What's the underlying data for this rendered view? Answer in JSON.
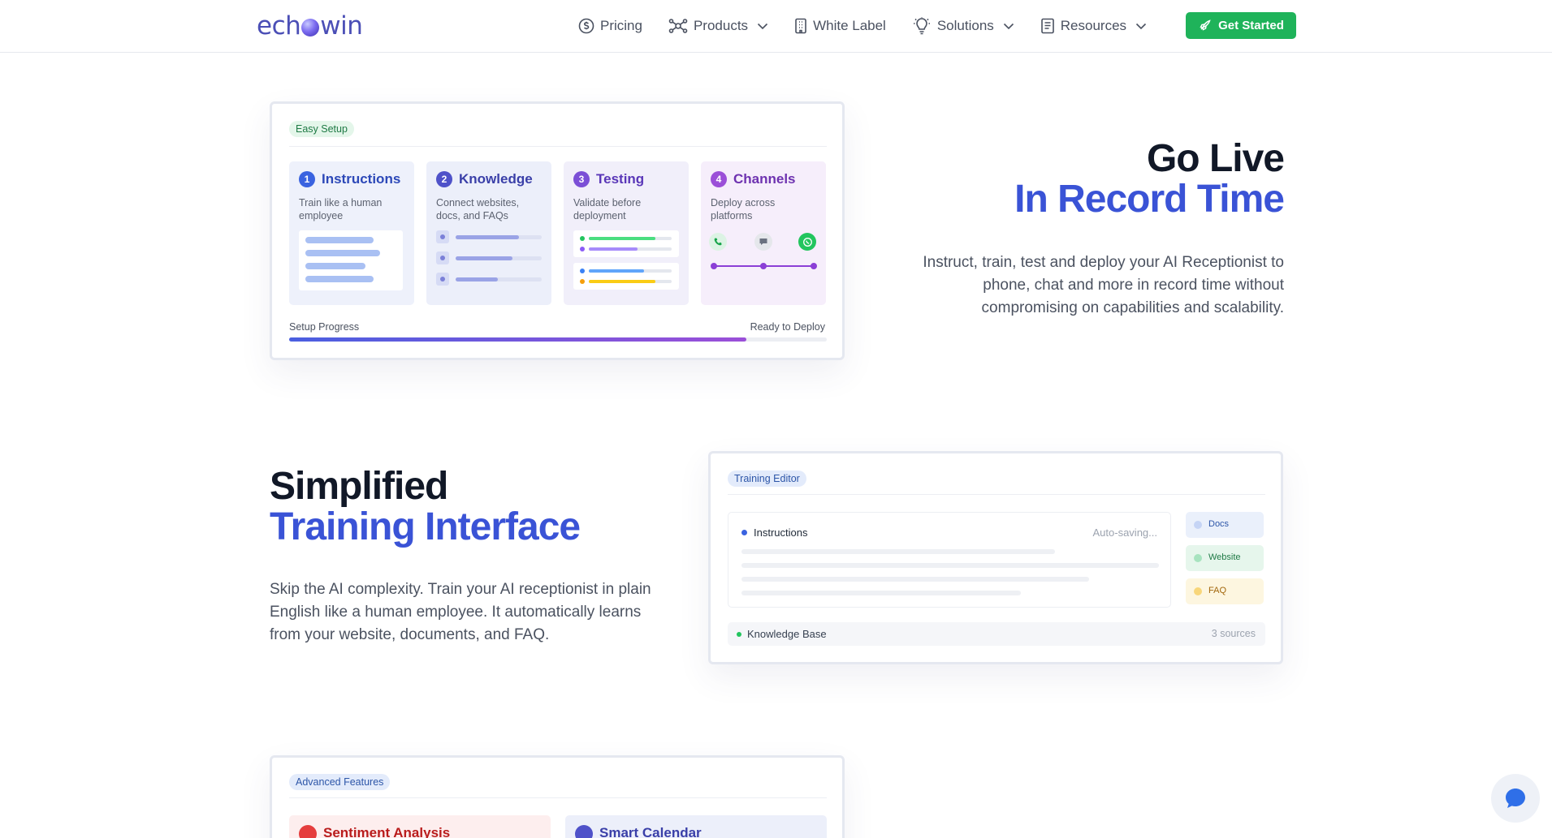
{
  "nav": {
    "logo_left": "ech",
    "logo_right": "win",
    "items": [
      {
        "label": "Pricing",
        "icon": "dollar-circle-icon",
        "dropdown": false
      },
      {
        "label": "Products",
        "icon": "network-icon",
        "dropdown": true
      },
      {
        "label": "White Label",
        "icon": "building-icon",
        "dropdown": false
      },
      {
        "label": "Solutions",
        "icon": "lightbulb-icon",
        "dropdown": true
      },
      {
        "label": "Resources",
        "icon": "book-icon",
        "dropdown": true
      }
    ],
    "cta_label": "Get Started"
  },
  "setup_card": {
    "badge": "Easy Setup",
    "steps": [
      {
        "num": "1",
        "title": "Instructions",
        "desc": "Train like a human employee"
      },
      {
        "num": "2",
        "title": "Knowledge",
        "desc": "Connect websites, docs, and FAQs"
      },
      {
        "num": "3",
        "title": "Testing",
        "desc": "Validate before deployment"
      },
      {
        "num": "4",
        "title": "Channels",
        "desc": "Deploy across platforms"
      }
    ],
    "progress_label": "Setup Progress",
    "progress_status": "Ready to Deploy",
    "progress_fraction": 0.85
  },
  "go_live": {
    "title_line1": "Go Live",
    "title_line2": "In Record Time",
    "body": "Instruct, train, test and deploy your AI Receptionist to phone, chat and more in record time without compromising on capabilities and scalability."
  },
  "training": {
    "title_line1": "Simplified",
    "title_line2": "Training Interface",
    "body": "Skip the AI complexity. Train your AI receptionist in plain English like a human employee. It automatically learns from your website, documents, and FAQ."
  },
  "editor_card": {
    "badge": "Training Editor",
    "instructions_label": "Instructions",
    "autosave": "Auto-saving...",
    "sources": [
      "Docs",
      "Website",
      "FAQ"
    ],
    "kb_label": "Knowledge Base",
    "kb_count": "3 sources"
  },
  "features_card": {
    "badge": "Advanced Features",
    "items": [
      "Sentiment Analysis",
      "Smart Calendar"
    ]
  },
  "colors": {
    "accent_blue": "#3a53d6",
    "cta_green": "#1fb35a"
  }
}
